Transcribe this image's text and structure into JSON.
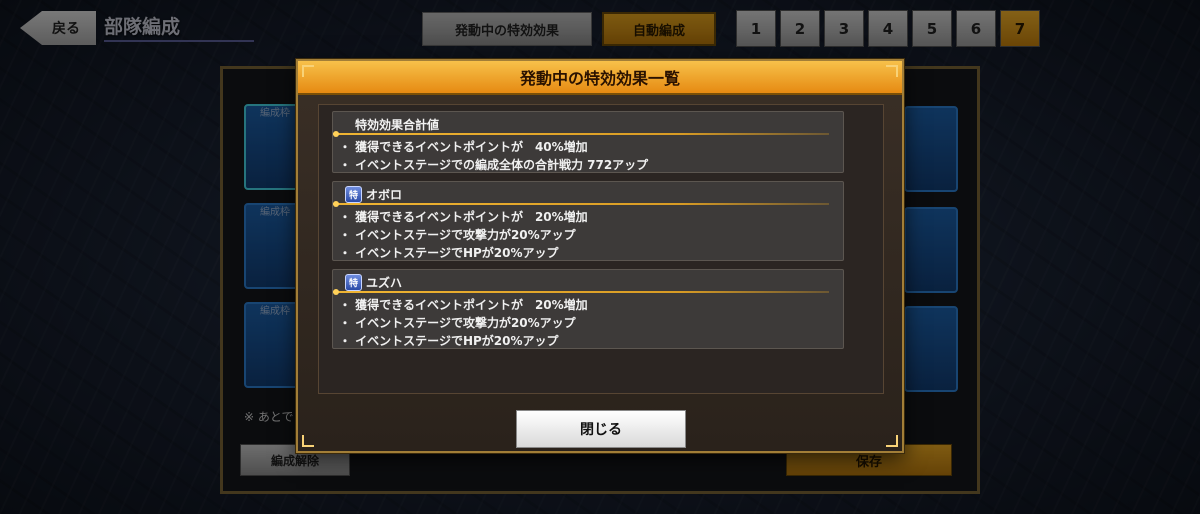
{
  "header": {
    "back_label": "戻る",
    "screen_title": "部隊編成",
    "active_effects_button": "発動中の特効効果",
    "auto_button": "自動編成",
    "tabs": [
      {
        "label": "1"
      },
      {
        "label": "2"
      },
      {
        "label": "3"
      },
      {
        "label": "4"
      },
      {
        "label": "5"
      },
      {
        "label": "6"
      },
      {
        "label": "7"
      }
    ],
    "active_tab": "7"
  },
  "background_panel": {
    "slot_label": "編成枠",
    "note_text": "※ あとで",
    "disband_button": "編成解除",
    "save_button": "保存"
  },
  "modal": {
    "title": "発動中の特効効果一覧",
    "badge_text": "特",
    "cards": [
      {
        "title": "特効効果合計値",
        "effects": [
          "・ 獲得できるイベントポイントが　40%増加",
          "・ イベントステージでの編成全体の合計戦力 772アップ"
        ]
      },
      {
        "title": "オボロ",
        "effects": [
          "・ 獲得できるイベントポイントが　20%増加",
          "・ イベントステージで攻撃力が20%アップ",
          "・ イベントステージでHPが20%アップ"
        ]
      },
      {
        "title": "ユズハ",
        "effects": [
          "・ 獲得できるイベントポイントが　20%増加",
          "・ イベントステージで攻撃力が20%アップ",
          "・ イベントステージでHPが20%アップ"
        ]
      }
    ],
    "close_button": "閉じる"
  },
  "colors": {
    "accent_gold": "#e68a12",
    "slot_blue": "#1c5fa8",
    "badge_blue": "#2a4aa6"
  }
}
